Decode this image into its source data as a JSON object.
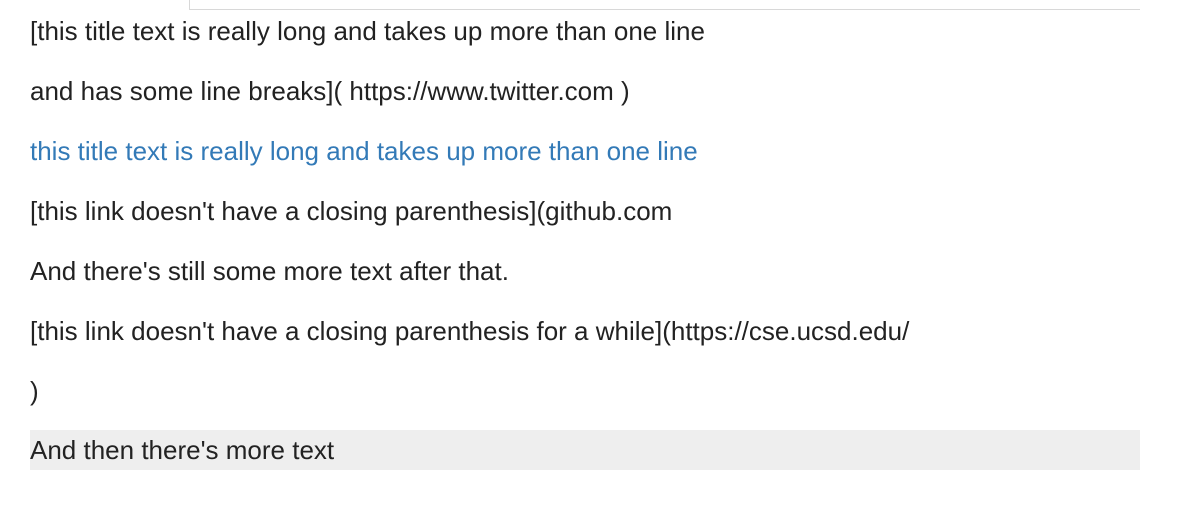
{
  "content": {
    "line1": "[this title text is really long and takes up more than one line",
    "line2": "and has some line breaks]( https://www.twitter.com )",
    "link_text": "this title text is really long and takes up more than one line",
    "line4": "[this link doesn't have a closing parenthesis](github.com",
    "line5": "And there's still some more text after that.",
    "line6": "[this link doesn't have a closing parenthesis for a while](https://cse.ucsd.edu/",
    "line7": ")",
    "line8": "And then there's more text"
  },
  "colors": {
    "text": "#222222",
    "link": "#337ab7",
    "highlight_background": "#eeeeee",
    "divider": "#d8d8d8"
  }
}
